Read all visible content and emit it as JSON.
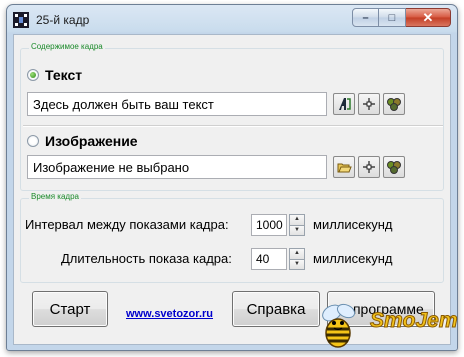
{
  "window": {
    "title": "25-й кадр",
    "caption": {
      "minimize": "–",
      "maximize": "□",
      "close": "✕"
    }
  },
  "content_frame": {
    "title": "Содержимое кадра",
    "text_option": {
      "label": "Текст",
      "selected": true,
      "value": "Здесь должен быть ваш текст",
      "buttons": [
        "font-icon",
        "position-icon",
        "color-icon"
      ]
    },
    "image_option": {
      "label": "Изображение",
      "selected": false,
      "value": "Изображение не выбрано",
      "buttons": [
        "open-folder-icon",
        "position-icon",
        "color-icon"
      ]
    }
  },
  "time_frame": {
    "title": "Время кадра",
    "interval": {
      "label": "Интервал между показами кадра:",
      "value": "1000",
      "unit": "миллисекунд"
    },
    "duration": {
      "label": "Длительность показа кадра:",
      "value": "40",
      "unit": "миллисекунд"
    }
  },
  "footer": {
    "start_label": "Старт",
    "link_text": "www.svetozor.ru",
    "help_label": "Справка",
    "about_label": "О программе"
  },
  "watermark": {
    "text": "SmoJem"
  },
  "colors": {
    "group_title": "#1a8a2a",
    "link": "#0000cc",
    "radio_selected": "#2e8a1a"
  }
}
